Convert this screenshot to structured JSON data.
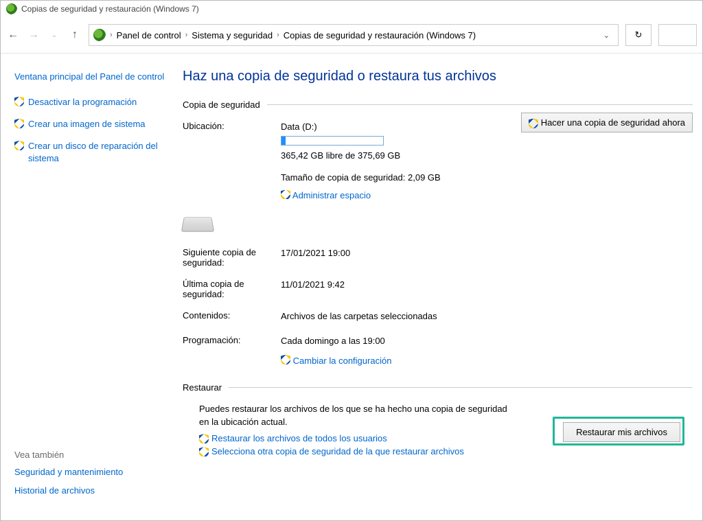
{
  "window": {
    "title": "Copias de seguridad y restauración (Windows 7)"
  },
  "breadcrumb": {
    "root": "Panel de control",
    "sys": "Sistema y seguridad",
    "page": "Copias de seguridad y restauración (Windows 7)"
  },
  "sidebar": {
    "home_link": "Ventana principal del Panel de control",
    "turn_off": "Desactivar la programación",
    "create_image": "Crear una imagen de sistema",
    "create_disc": "Crear un disco de reparación del sistema",
    "see_also_header": "Vea también",
    "see_also_1": "Seguridad y mantenimiento",
    "see_also_2": "Historial de archivos"
  },
  "page": {
    "title": "Haz una copia de seguridad o restaura tus archivos"
  },
  "backup": {
    "section": "Copia de seguridad",
    "location_label": "Ubicación:",
    "location_value": "Data (D:)",
    "free_space": "365,42 GB libre de 375,69 GB",
    "size_label": "Tamaño de copia de seguridad: 2,09 GB",
    "manage_link": "Administrar espacio",
    "backup_now_btn": "Hacer una copia de seguridad ahora",
    "next_label": "Siguiente copia de seguridad:",
    "next_value": "17/01/2021 19:00",
    "last_label": "Última copia de seguridad:",
    "last_value": "11/01/2021 9:42",
    "contents_label": "Contenidos:",
    "contents_value": "Archivos de las carpetas seleccionadas",
    "schedule_label": "Programación:",
    "schedule_value": "Cada domingo a las 19:00",
    "change_link": "Cambiar la configuración"
  },
  "restore": {
    "section": "Restaurar",
    "text": "Puedes restaurar los archivos de los que se ha hecho una copia de seguridad en la ubicación actual.",
    "all_users_link": "Restaurar los archivos de todos los usuarios",
    "other_backup_link": "Selecciona otra copia de seguridad de la que restaurar archivos",
    "restore_btn": "Restaurar mis archivos"
  }
}
